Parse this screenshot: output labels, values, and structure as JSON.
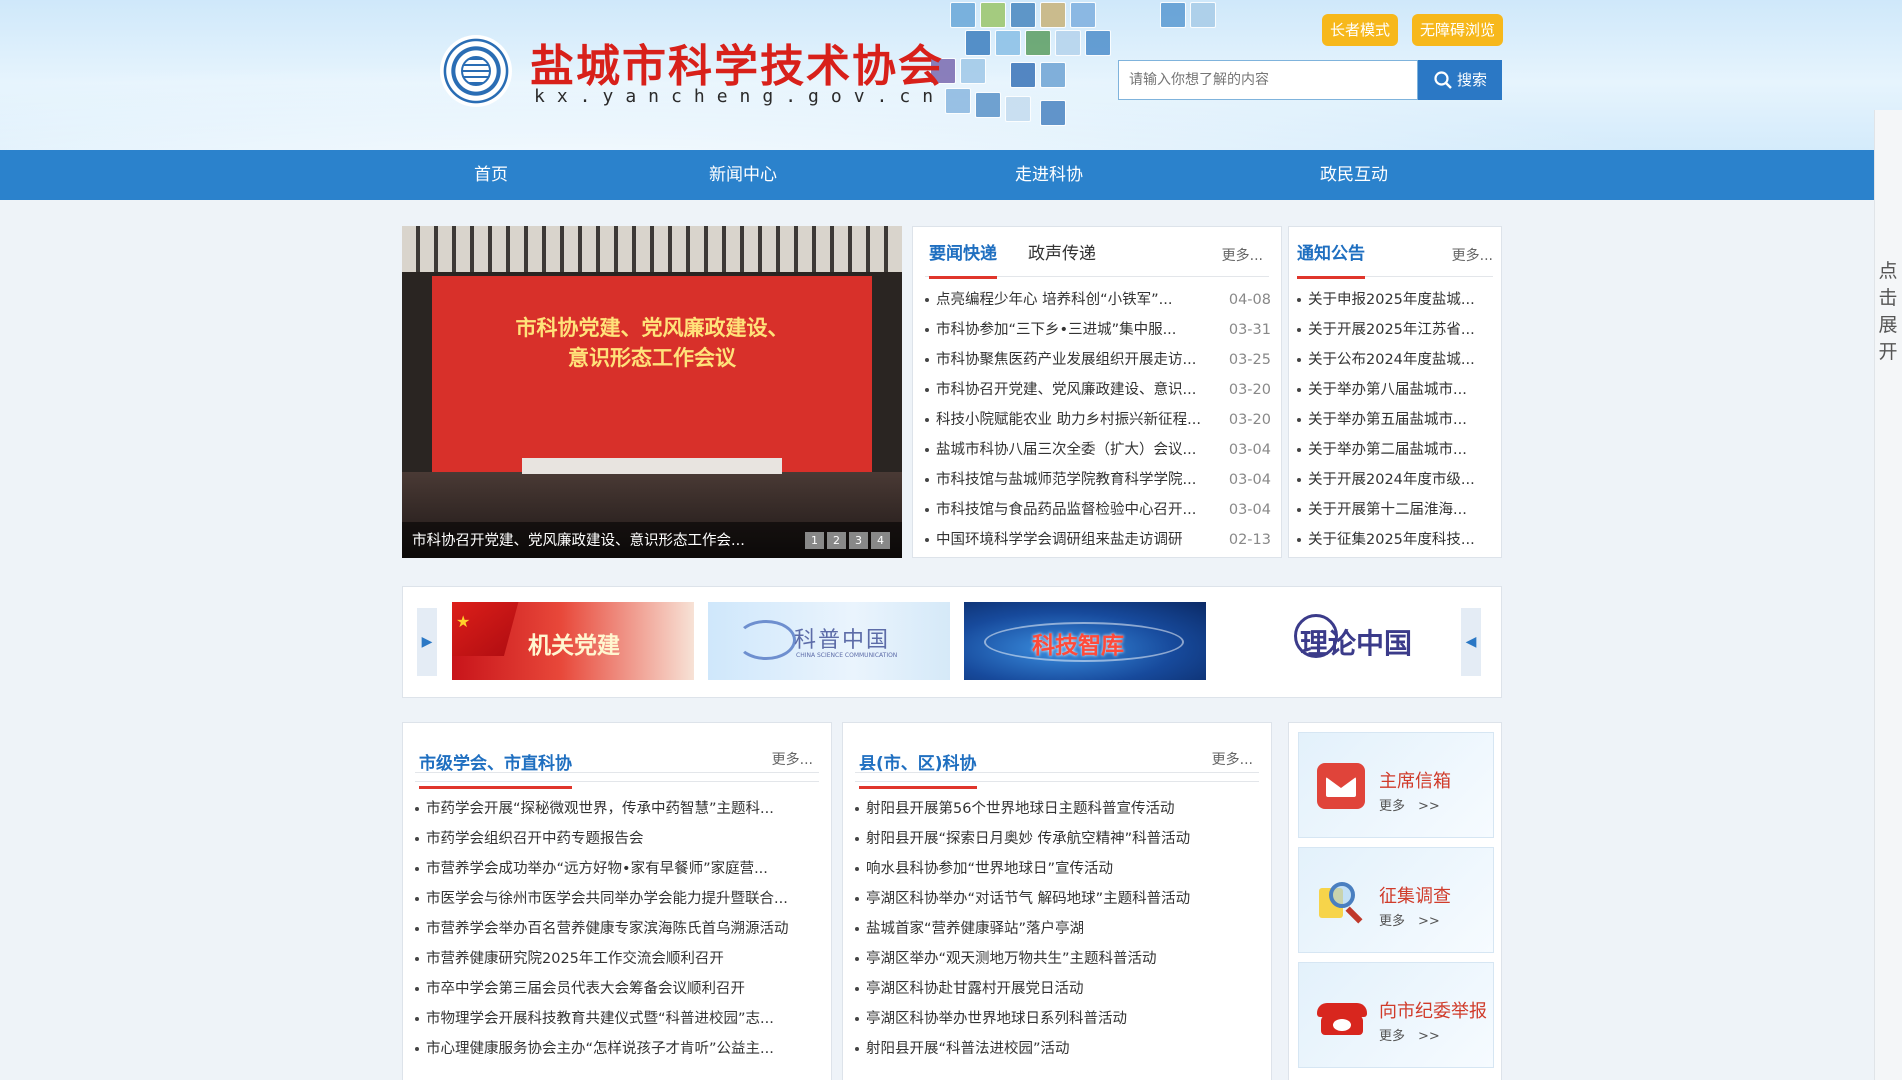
{
  "header": {
    "site_title": "盐城市科学技术协会",
    "site_domain": "kx.yancheng.gov.cn",
    "elder_mode": "长者模式",
    "accessible_mode": "无障碍浏览",
    "search_placeholder": "请输入你想了解的内容",
    "search_button": "搜索"
  },
  "nav": {
    "items": [
      "首页",
      "新闻中心",
      "走进科协",
      "政民互动"
    ]
  },
  "side": {
    "expand": "点击展开"
  },
  "slideshow": {
    "screen_line1": "市科协党建、党风廉政建设、",
    "screen_line2": "意识形态工作会议",
    "caption": "市科协召开党建、党风廉政建设、意识形态工作会...",
    "pages": [
      "1",
      "2",
      "3",
      "4"
    ]
  },
  "news": {
    "tab_active": "要闻快递",
    "tab_other": "政声传递",
    "more": "更多...",
    "items": [
      {
        "title": "点亮编程少年心 培养科创“小铁军”...",
        "date": "04-08"
      },
      {
        "title": "市科协参加“三下乡•三进城”集中服...",
        "date": "03-31"
      },
      {
        "title": "市科协聚焦医药产业发展组织开展走访...",
        "date": "03-25"
      },
      {
        "title": "市科协召开党建、党风廉政建设、意识...",
        "date": "03-20"
      },
      {
        "title": "科技小院赋能农业 助力乡村振兴新征程...",
        "date": "03-20"
      },
      {
        "title": "盐城市科协八届三次全委（扩大）会议...",
        "date": "03-04"
      },
      {
        "title": "市科技馆与盐城师范学院教育科学学院...",
        "date": "03-04"
      },
      {
        "title": "市科技馆与食品药品监督检验中心召开...",
        "date": "03-04"
      },
      {
        "title": "中国环境科学学会调研组来盐走访调研",
        "date": "02-13"
      }
    ]
  },
  "notices": {
    "tab_active": "通知公告",
    "more": "更多...",
    "items": [
      "关于申报2025年度盐城...",
      "关于开展2025年江苏省...",
      "关于公布2024年度盐城...",
      "关于举办第八届盐城市...",
      "关于举办第五届盐城市...",
      "关于举办第二届盐城市...",
      "关于开展2024年度市级...",
      "关于开展第十二届淮海...",
      "关于征集2025年度科技..."
    ]
  },
  "banners": {
    "items": [
      {
        "label": "机关党建"
      },
      {
        "label": "科普中国",
        "sub": "CHINA SCIENCE COMMUNICATION"
      },
      {
        "label": "科技智库"
      },
      {
        "label": "理论中国"
      }
    ]
  },
  "city_societies": {
    "title": "市级学会、市直科协",
    "more": "更多...",
    "items": [
      "市药学会开展“探秘微观世界，传承中药智慧”主题科...",
      "市药学会组织召开中药专题报告会",
      "市营养学会成功举办“远方好物•家有早餐师”家庭营...",
      "市医学会与徐州市医学会共同举办学会能力提升暨联合...",
      "市营养学会举办百名营养健康专家滨海陈氏首乌溯源活动",
      "市营养健康研究院2025年工作交流会顺利召开",
      "市卒中学会第三届会员代表大会筹备会议顺利召开",
      "市物理学会开展科技教育共建仪式暨“科普进校园”志...",
      "市心理健康服务协会主办“怎样说孩子才肯听”公益主..."
    ]
  },
  "county": {
    "title": "县(市、区)科协",
    "more": "更多...",
    "items": [
      "射阳县开展第56个世界地球日主题科普宣传活动",
      "射阳县开展“探索日月奥妙 传承航空精神”科普活动",
      "响水县科协参加“世界地球日”宣传活动",
      "亭湖区科协举办“对话节气 解码地球”主题科普活动",
      "盐城首家“营养健康驿站”落户亭湖",
      "亭湖区举办“观天测地万物共生”主题科普活动",
      "亭湖区科协赴甘露村开展党日活动",
      "亭湖区科协举办世界地球日系列科普活动",
      "射阳县开展“科普法进校园”活动"
    ]
  },
  "cards": {
    "items": [
      {
        "title": "主席信箱",
        "more": "更多　>>",
        "icon": "mailbox-icon",
        "color": "#e0443a"
      },
      {
        "title": "征集调查",
        "more": "更多　>>",
        "icon": "magnifier-icon",
        "color": "#f2a23a"
      },
      {
        "title": "向市纪委举报",
        "more": "更多　>>",
        "icon": "telephone-icon",
        "color": "#d8261e"
      }
    ]
  }
}
